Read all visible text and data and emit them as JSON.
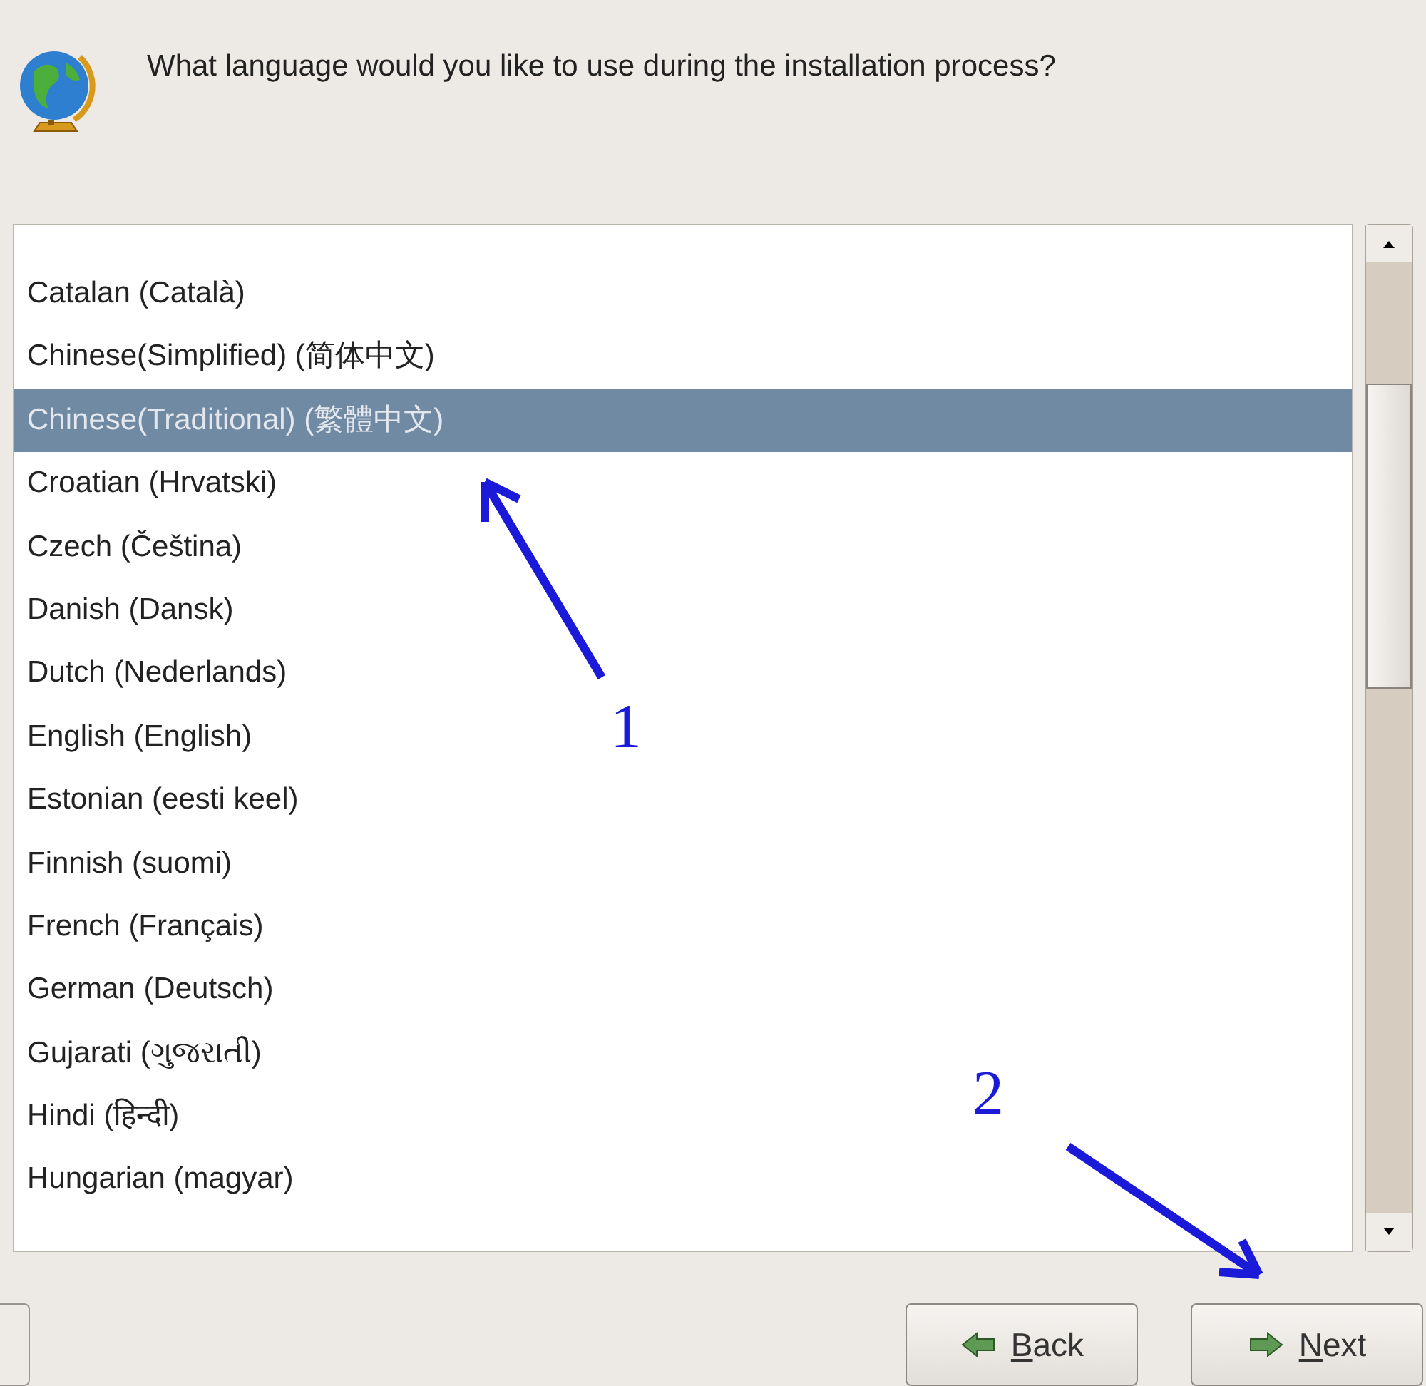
{
  "header": {
    "question": "What language would you like to use during the installation process?"
  },
  "languages": [
    {
      "label": "Catalan (Català)",
      "selected": false
    },
    {
      "label": "Chinese(Simplified) (简体中文)",
      "selected": false
    },
    {
      "label": "Chinese(Traditional) (繁體中文)",
      "selected": true
    },
    {
      "label": "Croatian (Hrvatski)",
      "selected": false
    },
    {
      "label": "Czech (Čeština)",
      "selected": false
    },
    {
      "label": "Danish (Dansk)",
      "selected": false
    },
    {
      "label": "Dutch (Nederlands)",
      "selected": false
    },
    {
      "label": "English (English)",
      "selected": false
    },
    {
      "label": "Estonian (eesti keel)",
      "selected": false
    },
    {
      "label": "Finnish (suomi)",
      "selected": false
    },
    {
      "label": "French (Français)",
      "selected": false
    },
    {
      "label": "German (Deutsch)",
      "selected": false
    },
    {
      "label": "Gujarati (ગુજરાતી)",
      "selected": false
    },
    {
      "label": "Hindi (हिन्दी)",
      "selected": false
    },
    {
      "label": "Hungarian (magyar)",
      "selected": false
    }
  ],
  "buttons": [
    {
      "label": "Back",
      "kind": "back"
    },
    {
      "label": "Next",
      "kind": "next"
    }
  ],
  "annotations": [
    {
      "label": "1",
      "kind": "up"
    },
    {
      "label": "2",
      "kind": "down"
    }
  ]
}
